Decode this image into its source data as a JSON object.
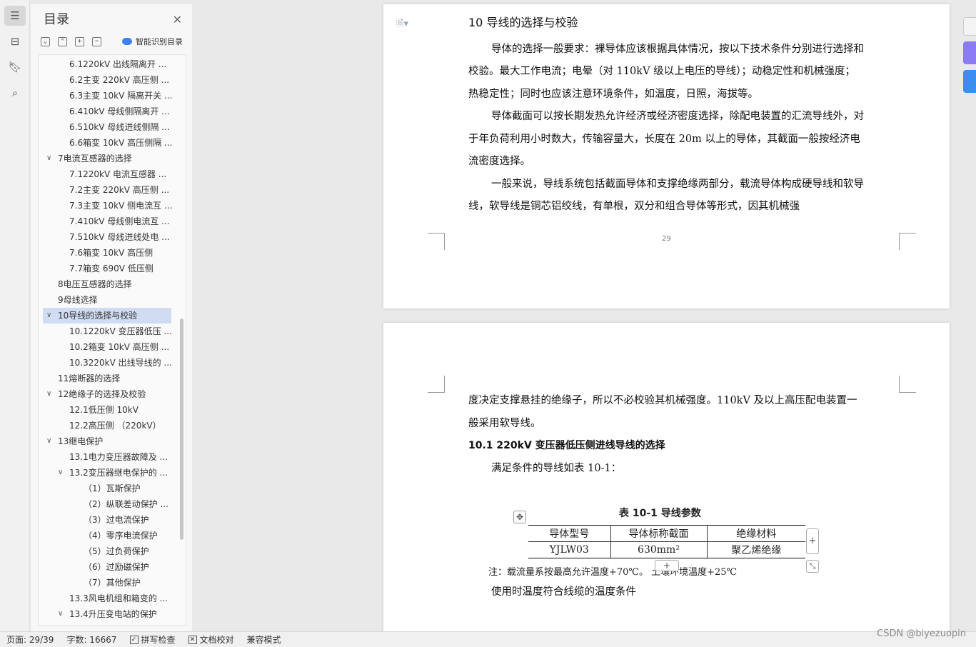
{
  "toc": {
    "title": "目录",
    "smart_label": "智能识别目录",
    "items": [
      {
        "text": "6.1220kV 出线隔离开 ...",
        "level": 2
      },
      {
        "text": "6.2主变 220kV 高压侧 ...",
        "level": 2
      },
      {
        "text": "6.3主变 10kV 隔离开关 ...",
        "level": 2
      },
      {
        "text": "6.410kV 母线侧隔离开 ...",
        "level": 2
      },
      {
        "text": "6.510kV 母线进线侧隔 ...",
        "level": 2
      },
      {
        "text": "6.6箱变 10kV 高压侧隔 ...",
        "level": 2
      },
      {
        "text": "7电流互感器的选择",
        "level": 1,
        "expand": true
      },
      {
        "text": "7.1220kV 电流互感器 ...",
        "level": 2
      },
      {
        "text": "7.2主变 220kV 高压侧 ...",
        "level": 2
      },
      {
        "text": "7.3主变 10kV 侧电流互 ...",
        "level": 2
      },
      {
        "text": "7.410kV 母线侧电流互 ...",
        "level": 2
      },
      {
        "text": "7.510kV 母线进线处电 ...",
        "level": 2
      },
      {
        "text": "7.6箱变 10kV 高压侧",
        "level": 2
      },
      {
        "text": "7.7箱变 690V 低压侧",
        "level": 2
      },
      {
        "text": "8电压互感器的选择",
        "level": 1
      },
      {
        "text": "9母线选择",
        "level": 1
      },
      {
        "text": "10导线的选择与校验",
        "level": 1,
        "expand": true,
        "selected": true
      },
      {
        "text": "10.1220kV 变压器低压 ...",
        "level": 2
      },
      {
        "text": "10.2箱变 10kV 高压侧 ...",
        "level": 2
      },
      {
        "text": "10.3220kV 出线导线的 ...",
        "level": 2
      },
      {
        "text": "11熔断器的选择",
        "level": 1
      },
      {
        "text": "12绝缘子的选择及校验",
        "level": 1,
        "expand": true
      },
      {
        "text": "12.1低压侧 10kV",
        "level": 2
      },
      {
        "text": "12.2高压侧 （220kV）",
        "level": 2
      },
      {
        "text": "13继电保护",
        "level": 1,
        "expand": true
      },
      {
        "text": "13.1电力变压器故障及 ...",
        "level": 2
      },
      {
        "text": "13.2变压器继电保护的 ...",
        "level": 2,
        "expand": true
      },
      {
        "text": "（1）瓦斯保护",
        "level": 3
      },
      {
        "text": "（2）纵联差动保护 ...",
        "level": 3
      },
      {
        "text": "（3）过电流保护",
        "level": 3
      },
      {
        "text": "（4）零序电流保护",
        "level": 3
      },
      {
        "text": "（5）过负荷保护",
        "level": 3
      },
      {
        "text": "（6）过励磁保护",
        "level": 3
      },
      {
        "text": "（7）其他保护",
        "level": 3
      },
      {
        "text": "13.3风电机组和箱变的 ...",
        "level": 2
      },
      {
        "text": "13.4升压变电站的保护",
        "level": 2,
        "expand": true
      }
    ]
  },
  "page1": {
    "heading": "10  导线的选择与校验",
    "para1": "导体的选择一般要求：裸导体应该根据具体情况，按以下技术条件分别进行选择和校验。最大工作电流；电晕（对 110kV 级以上电压的导线）；动稳定性和机械强度；热稳定性；同时也应该注意环境条件，如温度，日照，海拔等。",
    "para2": "导体截面可以按长期发热允许经济或经济密度选择，除配电装置的汇流导线外，对于年负荷利用小时数大，传输容量大，长度在 20m 以上的导体，其截面一般按经济电流密度选择。",
    "para3": "一般来说，导线系统包括截面导体和支撑绝缘两部分，载流导体构成硬导线和软导线，软导线是铜芯铝绞线，有单根，双分和组合导体等形式，因其机械强",
    "page_number": "29"
  },
  "page2": {
    "para1": "度决定支撑悬挂的绝缘子，所以不必校验其机械强度。110kV 及以上高压配电装置一般采用软导线。",
    "heading": "10.1  220kV 变压器低压侧进线导线的选择",
    "para2": "满足条件的导线如表 10-1：",
    "table_caption": "表 10-1  导线参数",
    "table": {
      "headers": [
        "导体型号",
        "导体标称截面",
        "绝缘材料"
      ],
      "row": [
        "YJLW03",
        "630mm²",
        "聚乙烯绝缘"
      ]
    },
    "note": "注：载流量系按最高允许温度+70℃。   土壤环境温度+25℃",
    "para3": "使用时温度符合线缆的温度条件"
  },
  "status": {
    "page": "页面: 29/39",
    "words": "字数: 16667",
    "spell": "拼写检查",
    "proof": "文档校对",
    "compat": "兼容模式"
  },
  "watermark": "CSDN @biyezuopin"
}
